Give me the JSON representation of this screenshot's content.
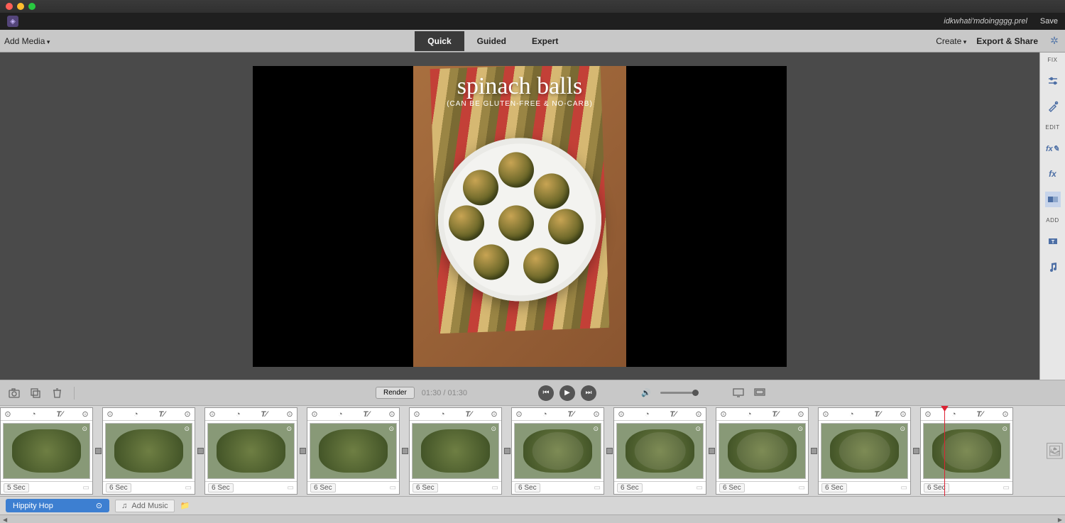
{
  "titlebar": {
    "project_name": "idkwhati'mdoingggg.prel",
    "save_label": "Save"
  },
  "menubar": {
    "add_media": "Add Media",
    "tabs": {
      "quick": "Quick",
      "guided": "Guided",
      "expert": "Expert"
    },
    "create": "Create",
    "export_share": "Export & Share"
  },
  "preview": {
    "title_text": "spinach balls",
    "subtitle_text": "(CAN BE GLUTEN-FREE & NO-CARB)"
  },
  "right_rail": {
    "fix_label": "FIX",
    "edit_label": "EDIT",
    "add_label": "ADD"
  },
  "controls": {
    "render": "Render",
    "time_current": "01:30",
    "time_total": "01:30"
  },
  "clips": [
    {
      "duration": "5 Sec"
    },
    {
      "duration": "6 Sec"
    },
    {
      "duration": "6 Sec"
    },
    {
      "duration": "6 Sec"
    },
    {
      "duration": "6 Sec"
    },
    {
      "duration": "6 Sec"
    },
    {
      "duration": "6 Sec"
    },
    {
      "duration": "6 Sec"
    },
    {
      "duration": "6 Sec"
    },
    {
      "duration": "6 Sec"
    }
  ],
  "audio": {
    "track_name": "Hippity Hop",
    "add_music": "Add Music"
  }
}
